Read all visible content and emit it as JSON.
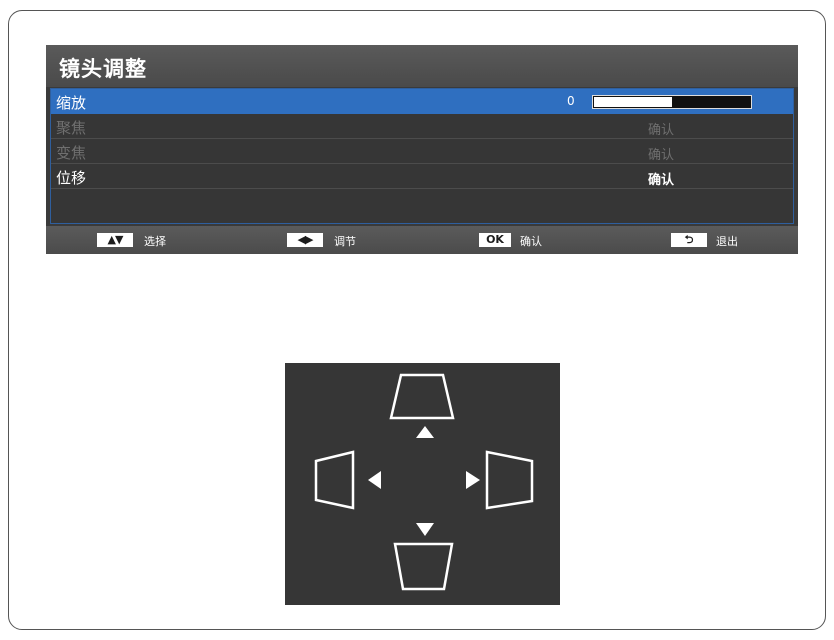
{
  "menu": {
    "title": "镜头调整",
    "rows": [
      {
        "label": "缩放",
        "value_text": "0",
        "progress": 0.5,
        "selected": true,
        "enabled": true
      },
      {
        "label": "聚焦",
        "action": "确认",
        "selected": false,
        "enabled": false
      },
      {
        "label": "变焦",
        "action": "确认",
        "selected": false,
        "enabled": false
      },
      {
        "label": "位移",
        "action": "确认",
        "selected": false,
        "enabled": true
      }
    ]
  },
  "footer": {
    "hints": [
      {
        "key": "▲▼",
        "label": "选择"
      },
      {
        "key": "◀▶",
        "label": "调节"
      },
      {
        "key": "OK",
        "label": "确认"
      },
      {
        "key": "⮌",
        "label": "退出"
      }
    ]
  },
  "diagram": {
    "directions": [
      "up",
      "down",
      "left",
      "right"
    ]
  },
  "colors": {
    "selection": "#2f6fc0",
    "menu_bg": "#3a3a3a",
    "disabled_text": "#6f6f6f"
  }
}
